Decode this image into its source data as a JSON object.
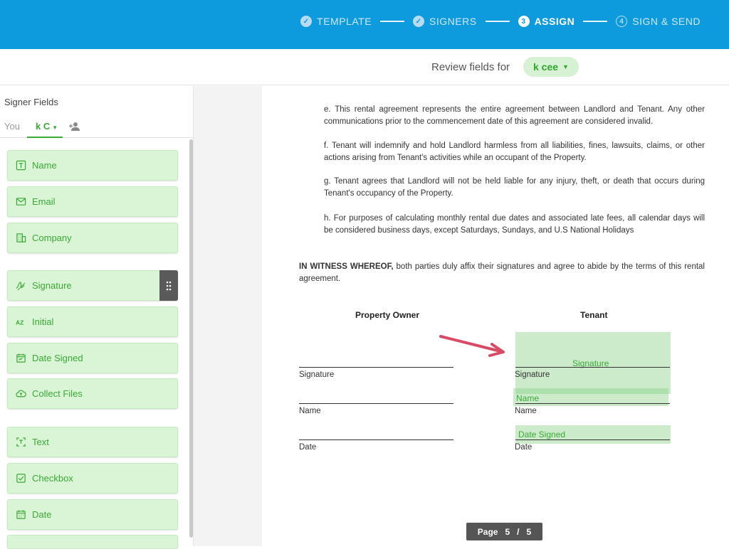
{
  "steps": [
    {
      "number": "",
      "label": "TEMPLATE",
      "state": "done"
    },
    {
      "number": "",
      "label": "SIGNERS",
      "state": "done"
    },
    {
      "number": "3",
      "label": "ASSIGN",
      "state": "active"
    },
    {
      "number": "4",
      "label": "SIGN & SEND",
      "state": "future"
    }
  ],
  "review": {
    "label": "Review fields for",
    "signer": "k cee"
  },
  "sidebar": {
    "title": "Signer Fields",
    "tab_you": "You",
    "tab_signer": "k C",
    "fields": [
      {
        "label": "Name",
        "icon": "name-field-icon"
      },
      {
        "label": "Email",
        "icon": "email-icon"
      },
      {
        "label": "Company",
        "icon": "company-icon"
      },
      {
        "label": "Signature",
        "icon": "signature-icon"
      },
      {
        "label": "Initial",
        "icon": "initial-icon"
      },
      {
        "label": "Date Signed",
        "icon": "date-signed-icon"
      },
      {
        "label": "Collect Files",
        "icon": "cloud-upload-icon"
      },
      {
        "label": "Text",
        "icon": "text-field-icon"
      },
      {
        "label": "Checkbox",
        "icon": "checkbox-icon"
      },
      {
        "label": "Date",
        "icon": "calendar-icon"
      }
    ]
  },
  "document": {
    "clauses": [
      "e.     This rental agreement represents the entire agreement between Landlord and Tenant. Any other communications prior to the commencement date of this agreement are considered invalid.",
      "f.      Tenant will indemnify and hold Landlord harmless from all liabilities, fines, lawsuits, claims, or other actions arising from Tenant's activities while an occupant of the Property.",
      "g.     Tenant agrees that Landlord will not be held liable for any injury, theft, or death that occurs during Tenant's occupancy of the Property.",
      "h.     For purposes of calculating monthly rental due dates and associated late fees, all calendar days will be considered business days, except Saturdays, Sundays, and U.S National Holidays"
    ],
    "witness_bold": "IN WITNESS WHEREOF,",
    "witness_rest": " both parties duly affix their signatures and agree to abide by the terms of this rental agreement.",
    "owner_heading": "Property Owner",
    "tenant_heading": "Tenant",
    "line_labels": {
      "signature": "Signature",
      "name": "Name",
      "date": "Date"
    },
    "placed_fields": {
      "signature": "Signature",
      "name": "Name",
      "date_signed": "Date Signed"
    }
  },
  "pagination": {
    "label": "Page",
    "current": "5",
    "separator": "/",
    "total": "5"
  },
  "colors": {
    "topbar": "#0e9bdd",
    "accent_green": "#3aa935",
    "field_bg": "#d9f5d6",
    "arrow": "#d94a64"
  }
}
